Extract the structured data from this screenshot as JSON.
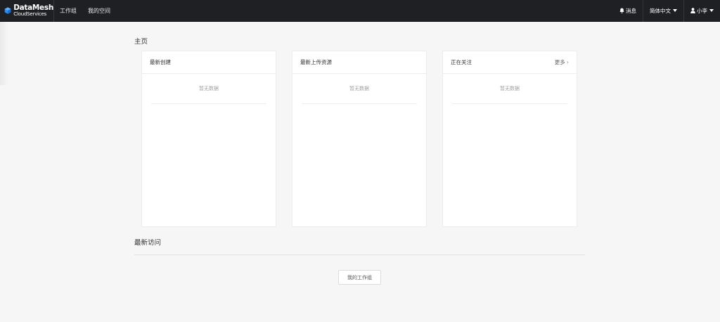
{
  "logo": {
    "line1": "DataMesh",
    "line2": "CloudServices"
  },
  "nav": {
    "items": [
      {
        "label": "工作组"
      },
      {
        "label": "我的空间"
      }
    ]
  },
  "topbar_right": {
    "messages_label": "消息",
    "language_label": "简体中文",
    "user_label": "小李"
  },
  "home": {
    "title": "主页",
    "cards": [
      {
        "title": "最新创建",
        "empty_text": "暂无数据"
      },
      {
        "title": "最新上传资源",
        "empty_text": "暂无数据"
      },
      {
        "title": "正在关注",
        "more_label": "更多",
        "empty_text": "暂无数据"
      }
    ]
  },
  "recent": {
    "title": "最新访问",
    "button_label": "我的工作组"
  },
  "icons": {
    "logo": "cube-logo-icon",
    "bell": "bell-icon",
    "user": "user-icon",
    "caret": "caret-down-icon",
    "chevron": "chevron-right-icon"
  },
  "colors": {
    "topbar": "#1e2024",
    "logo_accent": "#2c8df4",
    "background": "#f6f6f6",
    "card": "#ffffff"
  }
}
